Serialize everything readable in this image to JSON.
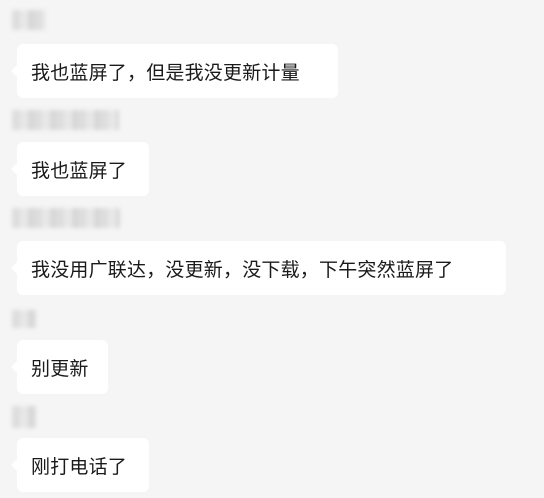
{
  "messages": [
    {
      "text": "我也蓝屏了，但是我没更新计量"
    },
    {
      "text": "我也蓝屏了"
    },
    {
      "text": "我没用广联达，没更新，没下载，下午突然蓝屏了"
    },
    {
      "text": "别更新"
    },
    {
      "text": "刚打电话了"
    }
  ]
}
